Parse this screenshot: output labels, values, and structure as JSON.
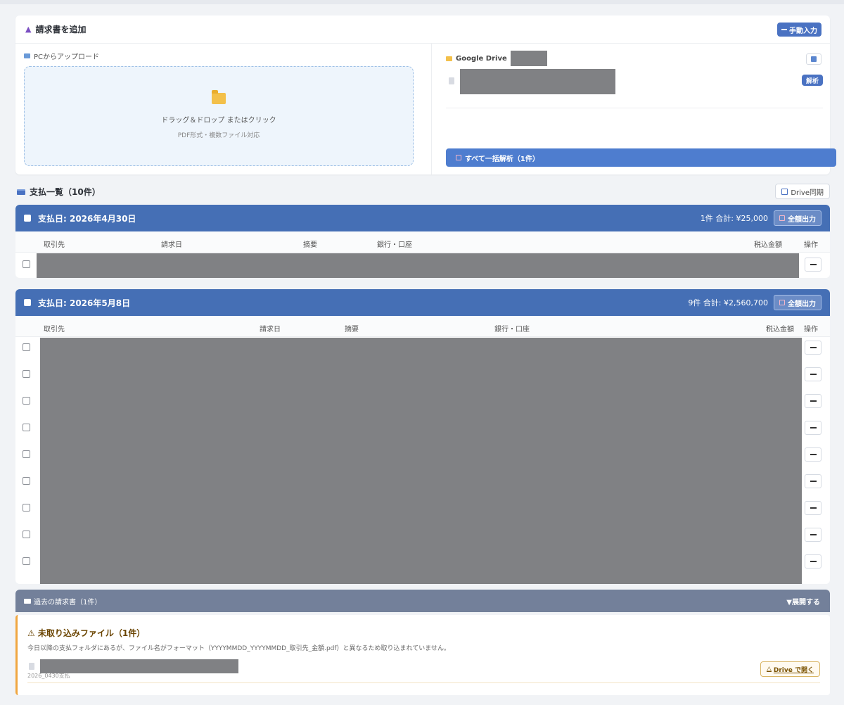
{
  "upload": {
    "title": "請求書を追加",
    "manual_button": "手動入力",
    "pc_label": "PCからアップロード",
    "dropzone_main": "ドラッグ＆ドロップ またはクリック",
    "dropzone_sub": "PDF形式・複数ファイル対応",
    "drive_label": "Google Drive",
    "analyze_button": "解析",
    "bulk_button": "すべて一括解析（1件）"
  },
  "payments": {
    "heading": "支払一覧（10件）",
    "sync_button": "Drive同期",
    "export_label": "全額出力",
    "groups": [
      {
        "title": "支払日: 2026年4月30日",
        "summary": "1件 合計: ¥25,000",
        "columns": [
          "取引先",
          "請求日",
          "摘要",
          "銀行・口座",
          "税込金額",
          "操作"
        ],
        "row_count": 1
      },
      {
        "title": "支払日: 2026年5月8日",
        "summary": "9件 合計: ¥2,560,700",
        "columns": [
          "取引先",
          "請求日",
          "摘要",
          "銀行・口座",
          "税込金額",
          "操作"
        ],
        "row_count": 9
      }
    ]
  },
  "past": {
    "title": "過去の請求書（1件）",
    "expand": "▼展開する"
  },
  "unimported": {
    "title": "⚠ 未取り込みファイル（1件）",
    "description": "今日以降の支払フォルダにあるが、ファイル名がフォーマット（YYYYMMDD_YYYYMMDD_取引先_金額.pdf）と異なるため取り込まれていません。",
    "folder": "2026_0430支払",
    "open_button": "Drive で開く"
  },
  "colors": {
    "header_blue": "#456fb5",
    "accent_blue": "#4a72c2",
    "warning": "#f0a640"
  }
}
